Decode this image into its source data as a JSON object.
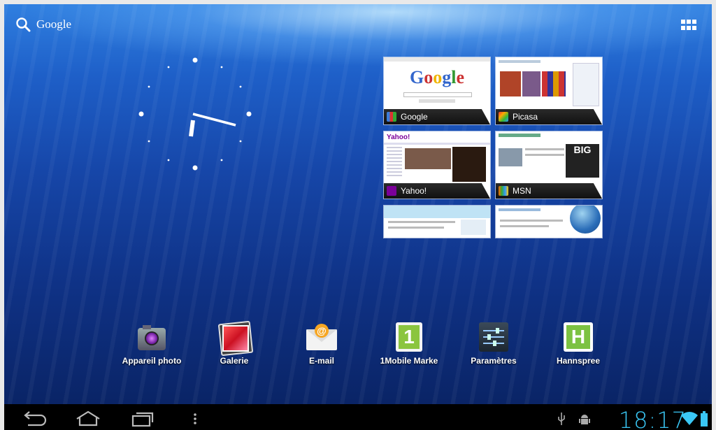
{
  "search": {
    "label": "Google",
    "icon": "search-icon"
  },
  "apps_button": {
    "icon": "all-apps-grid-icon"
  },
  "clock": {
    "hour_angle_deg": 208,
    "minute_angle_deg": 108
  },
  "bookmarks": [
    {
      "title": "Google",
      "favicon": "google-favicon-icon",
      "logo_text": "Google"
    },
    {
      "title": "Picasa",
      "favicon": "picasa-favicon-icon"
    },
    {
      "title": "Yahoo!",
      "favicon": "yahoo-favicon-icon"
    },
    {
      "title": "MSN",
      "favicon": "msn-favicon-icon",
      "badge": "BIG"
    },
    {
      "title": "",
      "favicon": ""
    },
    {
      "title": "",
      "favicon": ""
    }
  ],
  "dock": [
    {
      "label": "Appareil photo",
      "icon": "camera-icon"
    },
    {
      "label": "Galerie",
      "icon": "gallery-icon"
    },
    {
      "label": "E-mail",
      "icon": "email-icon"
    },
    {
      "label": "1Mobile Marke",
      "icon": "1mobile-market-icon",
      "glyph": "1"
    },
    {
      "label": "Paramètres",
      "icon": "settings-icon"
    },
    {
      "label": "Hannspree",
      "icon": "hannspree-icon",
      "glyph": "H"
    }
  ],
  "navbar": {
    "buttons": [
      "back-icon",
      "home-icon",
      "recent-apps-icon",
      "menu-icon"
    ],
    "status_icons": [
      "usb-icon",
      "android-debug-icon",
      "wifi-icon",
      "battery-icon"
    ],
    "time": "18:17"
  },
  "colors": {
    "time": "#3ac7f5",
    "wallpaper_deep": "#0a2466",
    "wallpaper_light": "#2f7fe0"
  }
}
